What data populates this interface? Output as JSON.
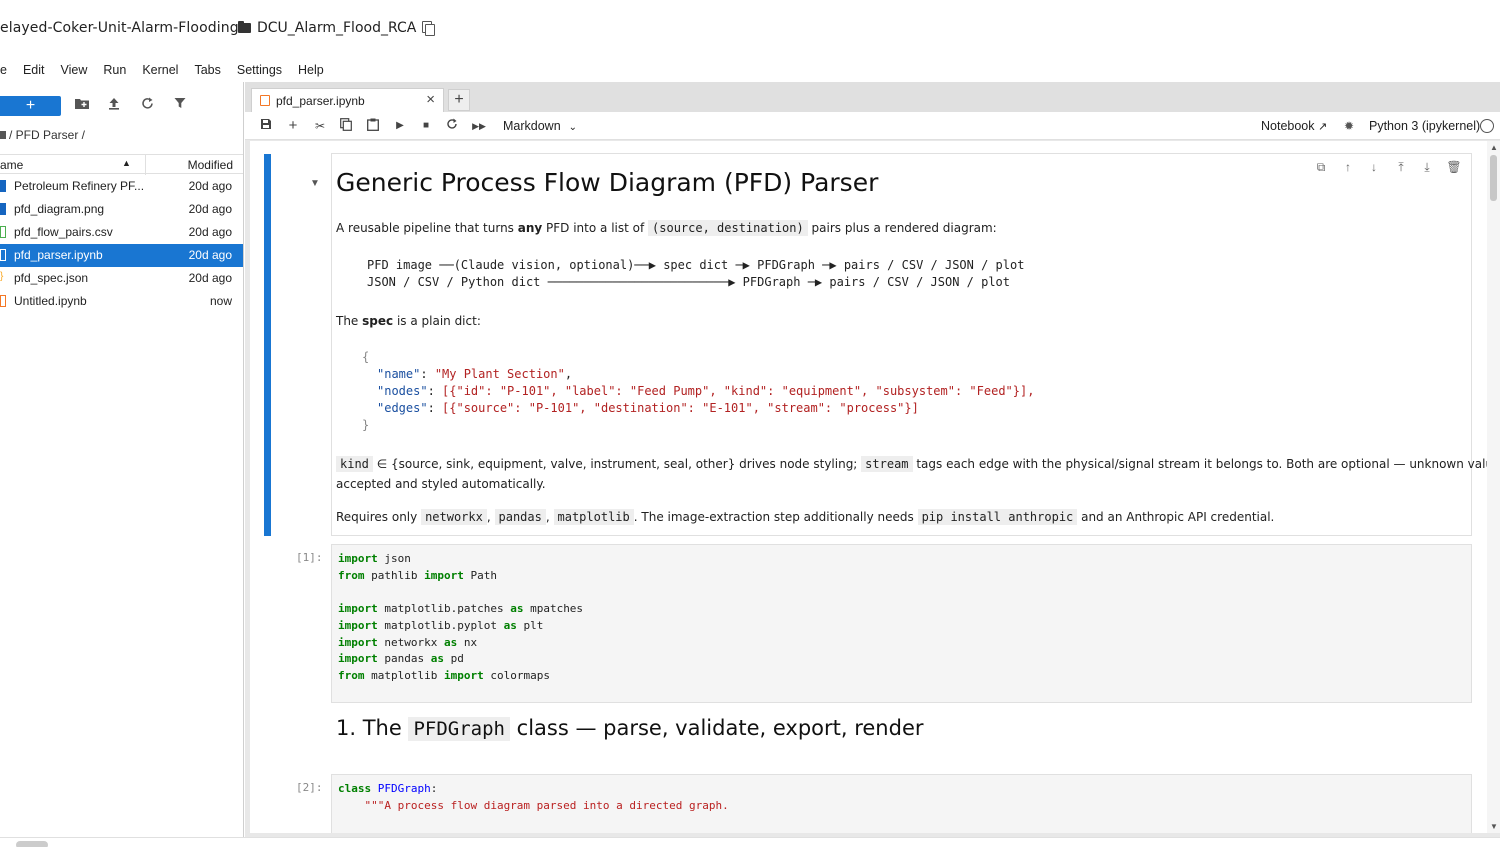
{
  "window": {
    "title": "elayed-Coker-Unit-Alarm-Flooding",
    "folder": "DCU_Alarm_Flood_RCA"
  },
  "menu": [
    "e",
    "Edit",
    "View",
    "Run",
    "Kernel",
    "Tabs",
    "Settings",
    "Help"
  ],
  "filebrowser": {
    "new_label": "+",
    "breadcrumb": "/ PFD Parser /",
    "col_name": "ame",
    "col_modified": "Modified",
    "files": [
      {
        "name": "Petroleum Refinery PF...",
        "modified": "20d ago",
        "icon": "document-icon",
        "color": "#1565c0"
      },
      {
        "name": "pfd_diagram.png",
        "modified": "20d ago",
        "icon": "image-icon",
        "color": "#1565c0"
      },
      {
        "name": "pfd_flow_pairs.csv",
        "modified": "20d ago",
        "icon": "spreadsheet-icon",
        "color": "#4caf50"
      },
      {
        "name": "pfd_parser.ipynb",
        "modified": "20d ago",
        "icon": "notebook-icon",
        "color": "#f37726",
        "selected": true
      },
      {
        "name": "pfd_spec.json",
        "modified": "20d ago",
        "icon": "json-icon",
        "color": "#f9a825"
      },
      {
        "name": "Untitled.ipynb",
        "modified": "now",
        "icon": "notebook-icon",
        "color": "#f37726"
      }
    ]
  },
  "tab": {
    "label": "pfd_parser.ipynb",
    "close": "×",
    "add": "+"
  },
  "toolbar": {
    "cell_type": "Markdown",
    "notebook_label": "Notebook",
    "kernel": "Python 3 (ipykernel)"
  },
  "cells": {
    "md": {
      "title": "Generic Process Flow Diagram (PFD) Parser",
      "intro_pre": "A reusable pipeline that turns ",
      "intro_bold": "any",
      "intro_mid": " PFD into a list of ",
      "intro_code": "(source, destination)",
      "intro_post": " pairs plus a rendered diagram:",
      "flow1": "PFD image ──(Claude vision, optional)──▶ spec dict ─▶ PFDGraph ─▶ pairs / CSV / JSON / plot",
      "flow2": "JSON / CSV / Python dict ─────────────────────────▶ PFDGraph ─▶ pairs / CSV / JSON / plot",
      "spec_pre": "The ",
      "spec_bold": "spec",
      "spec_post": " is a plain dict:",
      "json_open": "{",
      "json_name_key": "\"name\"",
      "json_name_val": "\"My Plant Section\"",
      "json_nodes_key": "\"nodes\"",
      "json_nodes_val": "[{\"id\": \"P-101\", \"label\": \"Feed Pump\", \"kind\": \"equipment\", \"subsystem\": \"Feed\"}],",
      "json_edges_key": "\"edges\"",
      "json_edges_val": "[{\"source\": \"P-101\", \"destination\": \"E-101\", \"stream\": \"process\"}]",
      "json_close": "}",
      "kind_code": "kind",
      "kind_text": " ∈ {source, sink, equipment, valve, instrument, seal, other} drives node styling; ",
      "stream_code": "stream",
      "stream_text": " tags each edge with the physical/signal stream it belongs to. Both are optional — unknown values are",
      "kind_text2": "accepted and styled automatically.",
      "req_pre": "Requires only ",
      "req_c1": "networkx",
      "req_c2": "pandas",
      "req_c3": "matplotlib",
      "req_mid": ". The image-extraction step additionally needs ",
      "req_c4": "pip install anthropic",
      "req_post": " and an Anthropic API credential."
    },
    "code1": {
      "prompt": "[1]:",
      "lines": [
        [
          "import",
          " json"
        ],
        [
          "from",
          " pathlib ",
          "import",
          " Path"
        ],
        [],
        [
          "import",
          " matplotlib.patches ",
          "as",
          " mpatches"
        ],
        [
          "import",
          " matplotlib.pyplot ",
          "as",
          " plt"
        ],
        [
          "import",
          " networkx ",
          "as",
          " nx"
        ],
        [
          "import",
          " pandas ",
          "as",
          " pd"
        ],
        [
          "from",
          " matplotlib ",
          "import",
          " colormaps"
        ]
      ]
    },
    "h2": {
      "num": "1. The ",
      "code": "PFDGraph",
      "rest": " class — parse, validate, export, render"
    },
    "code2": {
      "prompt": "[2]:",
      "kw": "class",
      "name": "PFDGraph",
      "colon": ":",
      "doc": "    \"\"\"A process flow diagram parsed into a directed graph."
    }
  }
}
